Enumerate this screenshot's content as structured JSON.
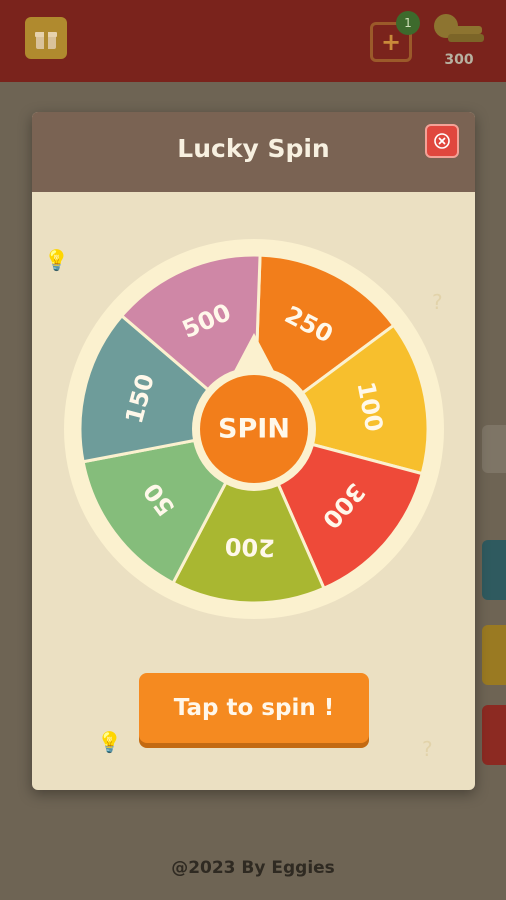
{
  "topbar": {
    "plus_label": "+",
    "plus_badge": "1",
    "coins": "300"
  },
  "modal": {
    "title": "Lucky Spin"
  },
  "wheel": {
    "center_label": "SPIN",
    "segments": [
      {
        "label": "250",
        "color": "#f27e1b"
      },
      {
        "label": "100",
        "color": "#f7bf2d"
      },
      {
        "label": "300",
        "color": "#ee4a39"
      },
      {
        "label": "200",
        "color": "#a9b731"
      },
      {
        "label": "50",
        "color": "#85bd7b"
      },
      {
        "label": "150",
        "color": "#6e9c9a"
      },
      {
        "label": "500",
        "color": "#cf87a6"
      }
    ]
  },
  "actions": {
    "tap_label": "Tap to spin !"
  },
  "footer": {
    "credit": "@2023 By Eggies"
  }
}
